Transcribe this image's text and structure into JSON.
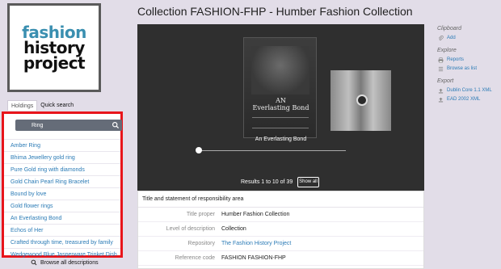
{
  "logo": {
    "line1": "fashion",
    "line2": "history",
    "line3": "project"
  },
  "tabs": {
    "holdings": "Holdings",
    "quick_search": "Quick search"
  },
  "search": {
    "value": "Ring"
  },
  "results": [
    "Amber Ring",
    "Bhima Jewellery gold ring",
    "Pure Gold ring with diamonds",
    "Gold Chain Pearl Ring Bracelet",
    "Bound by love",
    "Gold flower rings",
    "An Everlasting Bond",
    "Echos of Her",
    "Crafted through time, treasured by family",
    "Wedgewood Blue Jasperware Trinket Dish"
  ],
  "browse_all": "Browse all descriptions",
  "page_title": "Collection FASHION-FHP - Humber Fashion Collection",
  "viewer": {
    "thumb_title_line1": "AN",
    "thumb_title_line2": "Everlasting Bond",
    "caption": "An Everlasting Bond",
    "results_text": "Results 1 to 10 of 39",
    "show_all": "Show all"
  },
  "area": {
    "heading": "Title and statement of responsibility area",
    "fields": [
      {
        "label": "Title proper",
        "value": "Humber Fashion Collection"
      },
      {
        "label": "Level of description",
        "value": "Collection"
      },
      {
        "label": "Repository",
        "value": "The Fashion History Project"
      },
      {
        "label": "Reference code",
        "value": "FASHION FASHION-FHP"
      }
    ]
  },
  "sidebar": {
    "clipboard_title": "Clipboard",
    "add": "Add",
    "explore_title": "Explore",
    "reports": "Reports",
    "browse_as_list": "Browse as list",
    "export_title": "Export",
    "dublin_core": "Dublin Core 1.1 XML",
    "ead": "EAD 2002 XML"
  },
  "colors": {
    "highlight_border": "#e8151b",
    "link": "#2b7bb6",
    "logo_accent": "#3a8fb0",
    "viewer_bg": "#2f2f2f"
  }
}
